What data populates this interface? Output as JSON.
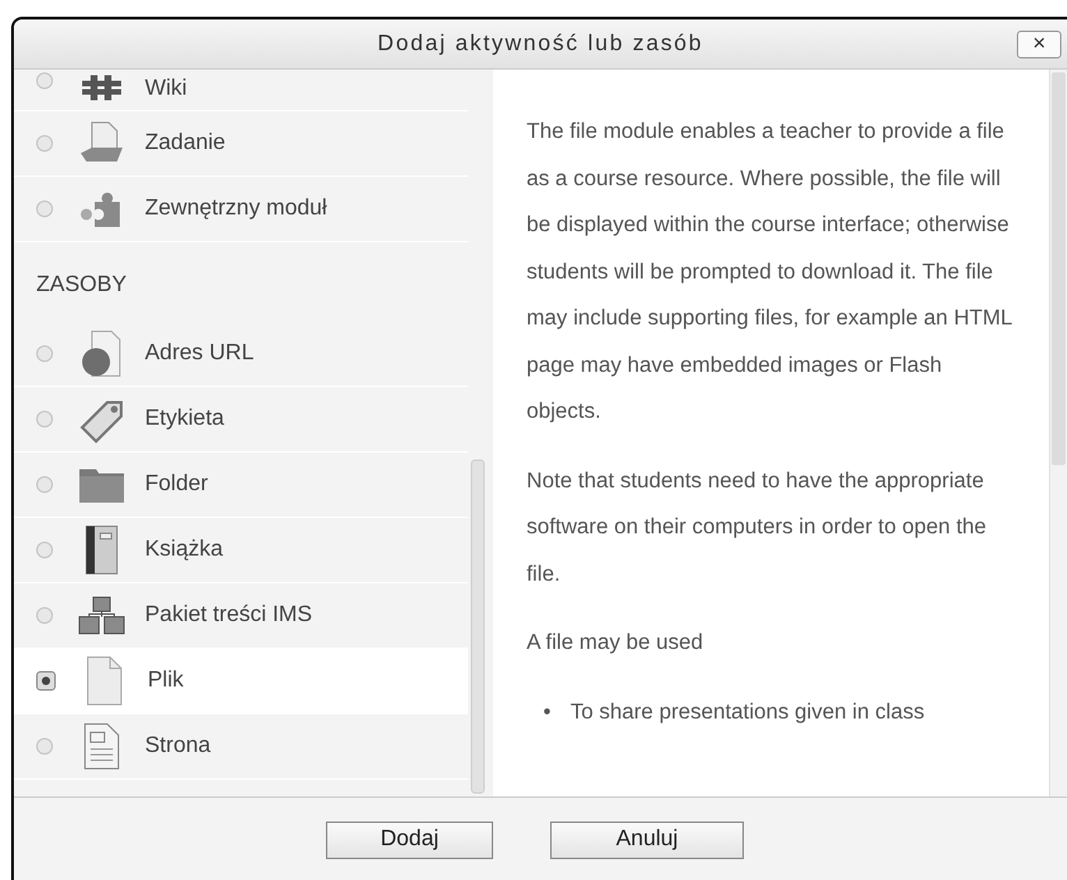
{
  "window": {
    "title": "Dodaj aktywność lub zasób",
    "close": "×"
  },
  "chooser": [
    {
      "kind": "item",
      "label": "Wiki",
      "selected": false
    },
    {
      "kind": "item",
      "label": "Zadanie",
      "selected": false
    },
    {
      "kind": "item",
      "label": "Zewnętrzny moduł",
      "selected": false
    },
    {
      "kind": "heading",
      "label": "ZASOBY"
    },
    {
      "kind": "item",
      "label": "Adres URL",
      "selected": false
    },
    {
      "kind": "item",
      "label": "Etykieta",
      "selected": false
    },
    {
      "kind": "item",
      "label": "Folder",
      "selected": false
    },
    {
      "kind": "item",
      "label": "Książka",
      "selected": false
    },
    {
      "kind": "item",
      "label": "Pakiet treści IMS",
      "selected": false
    },
    {
      "kind": "item",
      "label": "Plik",
      "selected": true
    },
    {
      "kind": "item",
      "label": "Strona",
      "selected": false
    }
  ],
  "description": {
    "paragraphs": [
      "The file module enables a teacher to provide a file as a course resource. Where possible, the file will be displayed within the course interface; otherwise students will be prompted to download it. The file may include supporting files, for example an HTML page may have embedded images or Flash objects.",
      "Note that students need to have the appropriate software on their computers in order to open the file.",
      "A file may be used"
    ],
    "bullets": [
      {
        "marker": "•",
        "text": "To share presentations given in class"
      }
    ]
  },
  "buttons": [
    "Dodaj",
    "Anuluj"
  ]
}
